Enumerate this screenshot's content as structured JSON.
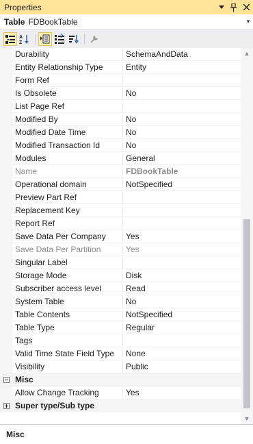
{
  "window": {
    "title": "Properties"
  },
  "object_selector": {
    "type": "Table",
    "name": "FDBookTable"
  },
  "toolbar": {
    "tools": [
      {
        "name": "categorized-icon",
        "active": true
      },
      {
        "name": "alphabetical-icon",
        "active": false
      },
      {
        "name": "properties-icon",
        "active": true
      },
      {
        "name": "events-icon",
        "active": false
      },
      {
        "name": "sort-icon",
        "active": false
      },
      {
        "name": "property-pages-icon",
        "active": false
      }
    ]
  },
  "rows": [
    {
      "name": "Durability",
      "value": "SchemaAndData"
    },
    {
      "name": "Entity Relationship Type",
      "value": "Entity"
    },
    {
      "name": "Form Ref",
      "value": ""
    },
    {
      "name": "Is Obsolete",
      "value": "No"
    },
    {
      "name": "List Page Ref",
      "value": ""
    },
    {
      "name": "Modified By",
      "value": "No"
    },
    {
      "name": "Modified Date Time",
      "value": "No"
    },
    {
      "name": "Modified Transaction Id",
      "value": "No"
    },
    {
      "name": "Modules",
      "value": "General"
    },
    {
      "name": "Name",
      "value": "FDBookTable"
    },
    {
      "name": "Operational domain",
      "value": "NotSpecified"
    },
    {
      "name": "Preview Part Ref",
      "value": ""
    },
    {
      "name": "Replacement Key",
      "value": ""
    },
    {
      "name": "Report Ref",
      "value": ""
    },
    {
      "name": "Save Data Per Company",
      "value": "Yes"
    },
    {
      "name": "Save Data Per Partition",
      "value": "Yes"
    },
    {
      "name": "Singular Label",
      "value": ""
    },
    {
      "name": "Storage Mode",
      "value": "Disk"
    },
    {
      "name": "Subscriber access level",
      "value": "Read"
    },
    {
      "name": "System Table",
      "value": "No"
    },
    {
      "name": "Table Contents",
      "value": "NotSpecified"
    },
    {
      "name": "Table Type",
      "value": "Regular"
    },
    {
      "name": "Tags",
      "value": ""
    },
    {
      "name": "Valid Time State Field Type",
      "value": "None"
    },
    {
      "name": "Visibility",
      "value": "Public"
    }
  ],
  "categories": {
    "misc": {
      "label": "Misc",
      "expanded": true,
      "rows": [
        {
          "name": "Allow Change Tracking",
          "value": "Yes"
        }
      ]
    },
    "super_sub": {
      "label": "Super type/Sub type",
      "expanded": false
    }
  },
  "description": {
    "title": "Misc"
  },
  "colors": {
    "title_bar": "#ffe398",
    "toolbar": "#eeeef2",
    "disabled_text": "#8d8d8d"
  }
}
